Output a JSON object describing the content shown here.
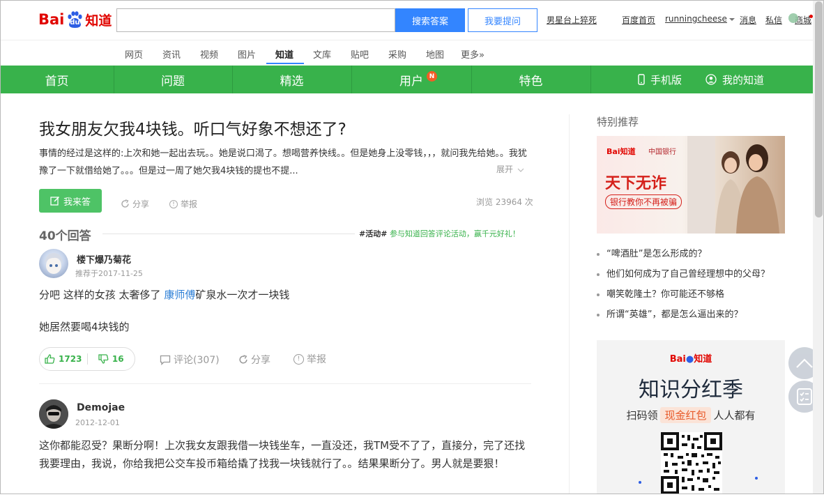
{
  "header": {
    "logo_bai": "Bai",
    "logo_du": "du",
    "logo_zhidao": "知道",
    "search_placeholder": "",
    "search_button": "搜索答案",
    "ask_button": "我要提问",
    "hot_link": "男星台上猝死",
    "links": {
      "baidu_home": "百度首页",
      "username": "runningcheese",
      "messages": "消息",
      "private_msg": "私信",
      "mall": "商城"
    }
  },
  "subnav": {
    "items": [
      "网页",
      "资讯",
      "视频",
      "图片",
      "知道",
      "文库",
      "贴吧",
      "采购",
      "地图",
      "更多»"
    ],
    "active": "知道"
  },
  "greenbar": {
    "items": [
      "首页",
      "问题",
      "精选",
      "用户",
      "特色"
    ],
    "user_badge": "N",
    "mobile": "手机版",
    "my_zhidao": "我的知道"
  },
  "question": {
    "title": "我女朋友欠我4块钱。听口气好象不想还了?",
    "description": "事情的经过是这样的:上次和她一起出去玩。。她是说口渴了。想喝营养快线。。但是她身上没零钱，，，就问我先给她。。我犹豫了一下就借给她了。。。但是过一周了她欠我4块钱的提也不提...",
    "expand": "展开",
    "answer_button": "我来答",
    "share": "分享",
    "report": "举报",
    "views": "浏览 23964 次"
  },
  "answers_header": {
    "count": "40个回答",
    "activity_tag": "#活动#",
    "activity_text": "参与知道回答评论活动，赢千元好礼！"
  },
  "answers": [
    {
      "user": "楼下爆乃菊花",
      "date": "推荐于2017-11-25",
      "text_before": "分吧 这样的女孩 太奢侈了 ",
      "link": "康师傅",
      "text_after": "矿泉水一次才一块钱",
      "text_line2": "她居然要喝4块钱的",
      "likes": "1723",
      "dislikes": "16",
      "comments": "评论(307)",
      "share": "分享",
      "report": "举报"
    },
    {
      "user": "Demojae",
      "date": "2012-12-01",
      "text": "这你都能忍受？果断分啊！上次我女友跟我借一块钱坐车，一直没还，我TM受不了了，直接分，完了还找我要理由，我说，你给我把公交车投币箱给撬了找我一块钱就行了。。结果果断分了。男人就是要狠！"
    }
  ],
  "sidebar": {
    "title": "特别推荐",
    "ad_slogan": "天下无诈",
    "ad_sub": "银行教你不再被骗",
    "ad_logo": "Bai知道",
    "ad_bank": "中国银行",
    "recommend": [
      "“啤酒肚”是怎么形成的？",
      "他们如何成为了自己曾经理想中的父母？",
      "嘲笑乾隆土？你可能还不够格",
      "所谓“英雄”，都是怎么逼出来的？"
    ],
    "promo_logo_bai": "Bai",
    "promo_logo_zhidao": "知道",
    "promo_title": "知识分红季",
    "promo_sub_left": "扫码领",
    "promo_sub_red": "现金红包",
    "promo_sub_right": "人人都有"
  },
  "colors": {
    "green": "#38b24b",
    "blue": "#3385ff",
    "red": "#e10601"
  }
}
